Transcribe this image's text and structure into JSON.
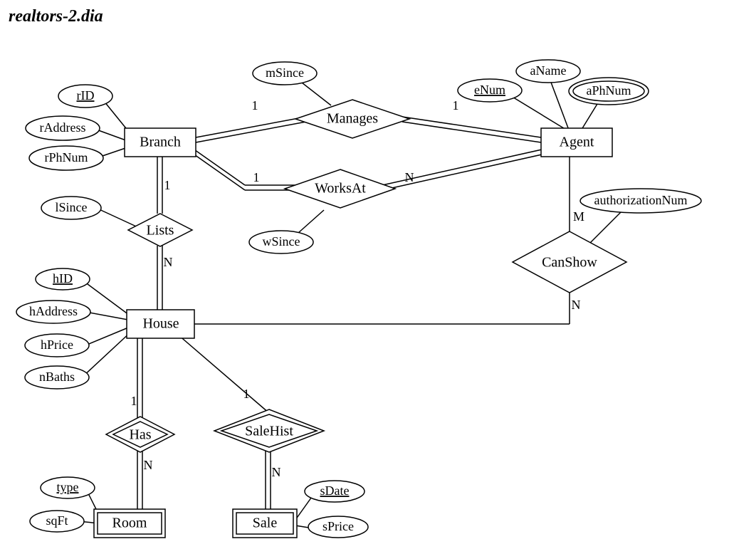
{
  "title": "realtors-2.dia",
  "entities": {
    "branch": "Branch",
    "agent": "Agent",
    "house": "House",
    "room": "Room",
    "sale": "Sale"
  },
  "relationships": {
    "manages": "Manages",
    "worksAt": "WorksAt",
    "lists": "Lists",
    "canShow": "CanShow",
    "has": "Has",
    "saleHist": "SaleHist"
  },
  "attributes": {
    "rID": "rID",
    "rAddress": "rAddress",
    "rPhNum": "rPhNum",
    "mSince": "mSince",
    "aName": "aName",
    "eNum": "eNum",
    "aPhNum": "aPhNum",
    "wSince": "wSince",
    "lSince": "lSince",
    "authorizationNum": "authorizationNum",
    "hID": "hID",
    "hAddress": "hAddress",
    "hPrice": "hPrice",
    "nBaths": "nBaths",
    "type": "type",
    "sqFt": "sqFt",
    "sDate": "sDate",
    "sPrice": "sPrice"
  },
  "cardinalities": {
    "manages_branch": "1",
    "manages_agent": "1",
    "worksAt_branch": "1",
    "worksAt_agent": "N",
    "lists_branch": "1",
    "lists_house": "N",
    "canShow_agent": "M",
    "canShow_house": "N",
    "has_house": "1",
    "has_room": "N",
    "saleHist_house": "1",
    "saleHist_sale": "N"
  }
}
